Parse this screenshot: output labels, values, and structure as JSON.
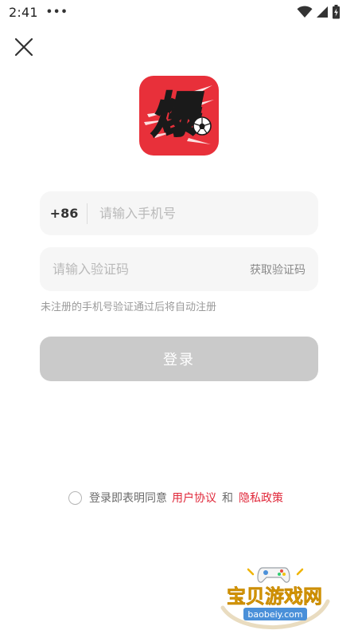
{
  "status_bar": {
    "time": "2:41",
    "overflow": "•••",
    "icons": [
      "wifi-icon",
      "signal-icon",
      "battery-icon"
    ]
  },
  "header": {
    "close_icon": "close-icon"
  },
  "logo": {
    "glyph": "爆",
    "background_color": "#e8303a",
    "icon": "football-icon"
  },
  "form": {
    "country_code": "+86",
    "phone_placeholder": "请输入手机号",
    "phone_value": "",
    "code_placeholder": "请输入验证码",
    "code_value": "",
    "get_code_label": "获取验证码",
    "hint": "未注册的手机号验证通过后将自动注册",
    "login_label": "登录"
  },
  "agreement": {
    "checked": false,
    "prefix": "登录即表明同意",
    "user_agreement": "用户协议",
    "and": "和",
    "privacy_policy": "隐私政策",
    "link_color": "#e0283a"
  },
  "watermark": {
    "title": "宝贝游戏网",
    "url": "baobeiy.com"
  }
}
